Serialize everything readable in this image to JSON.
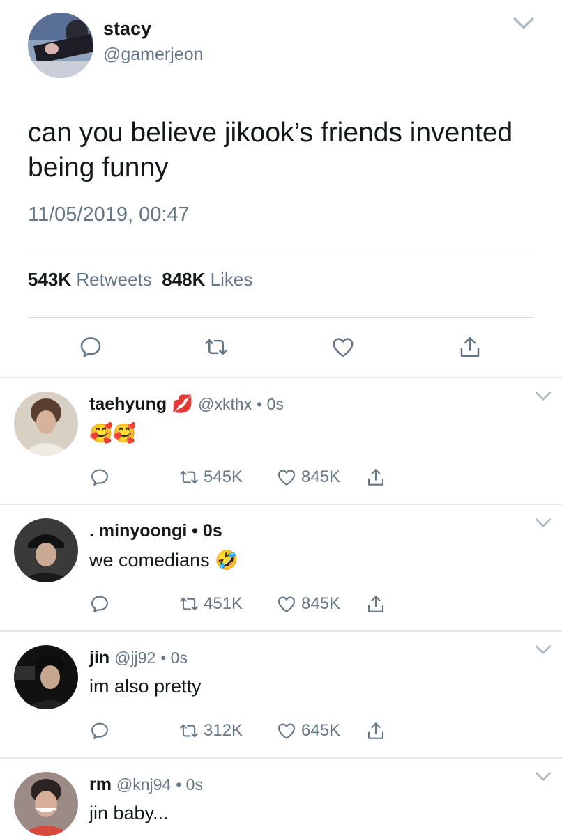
{
  "main_tweet": {
    "name": "stacy",
    "handle": "@gamerjeon",
    "text": "can you believe jikook’s friends invented being funny",
    "timestamp": "11/05/2019, 00:47",
    "retweets_count": "543K",
    "retweets_label": "Retweets",
    "likes_count": "848K",
    "likes_label": "Likes"
  },
  "replies": [
    {
      "name": "taehyung",
      "name_emoji": "💋",
      "handle": "@xkthx",
      "dot_time": "• 0s",
      "text": "🥰🥰",
      "retweets": "545K",
      "likes": "845K"
    },
    {
      "name": ". minyoongi",
      "handle": "",
      "dot_time": "• 0s",
      "text": "we comedians 🤣",
      "retweets": "451K",
      "likes": "845K"
    },
    {
      "name": "jin",
      "handle": "@jj92",
      "dot_time": "• 0s",
      "text": "im also pretty",
      "retweets": "312K",
      "likes": "645K"
    },
    {
      "name": "rm",
      "handle": "@knj94",
      "dot_time": "• 0s",
      "text": "jin baby...",
      "retweets": "",
      "likes": ""
    }
  ],
  "colors": {
    "text": "#14171a",
    "secondary": "#657786",
    "icon": "#657786",
    "divider": "#e1e8ed"
  },
  "icons": [
    "reply-icon",
    "retweet-icon",
    "like-icon",
    "share-icon",
    "chevron-down-icon"
  ]
}
